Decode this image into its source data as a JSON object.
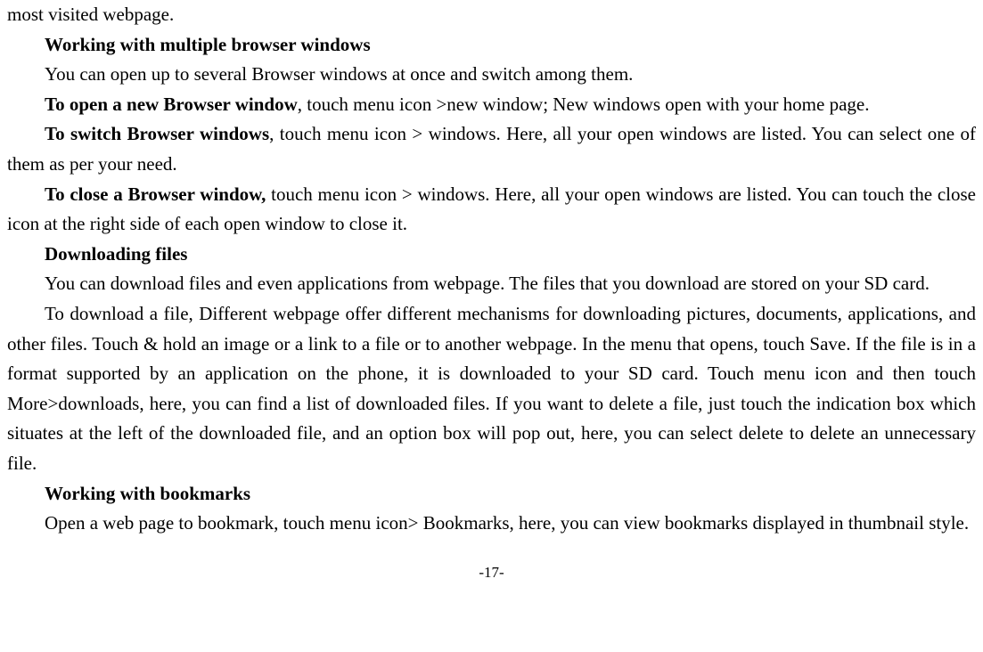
{
  "doc": {
    "line1": "most visited webpage.",
    "heading1": "Working with multiple browser windows",
    "line2": "You can open up to several Browser windows at once and switch among them.",
    "line3_bold": "To open a new Browser window",
    "line3_rest": ", touch menu icon >new window; New windows open with your home page.",
    "line4_bold": "To switch Browser windows",
    "line4_rest": ", touch menu icon > windows. Here, all your open windows are listed. You can select one of them as per your need.",
    "line5_bold": "To close a Browser window,",
    "line5_rest": " touch menu icon > windows. Here, all your open windows are listed. You can touch the close icon at the right side of each open window to close it.",
    "heading2": "Downloading files",
    "line6": "You can download files and even applications from webpage. The files that you download are stored on your SD card.",
    "line7": "To download a file, Different webpage offer different mechanisms for downloading pictures, documents, applications, and other files. Touch & hold an image or a link to a file or to another webpage. In the menu that opens, touch Save. If the file is in a format supported by an application on the phone, it is downloaded to your SD card. Touch menu icon and then touch More>downloads, here, you can find a list of downloaded files. If you want to delete a file, just touch the indication box which situates at the left of the downloaded file, and an option box will pop out, here, you can select delete to delete an unnecessary file.",
    "heading3": "Working with bookmarks",
    "line8": "Open a web page to bookmark, touch menu icon> Bookmarks, here, you can view bookmarks displayed in thumbnail style.",
    "page_number": "-17-"
  }
}
